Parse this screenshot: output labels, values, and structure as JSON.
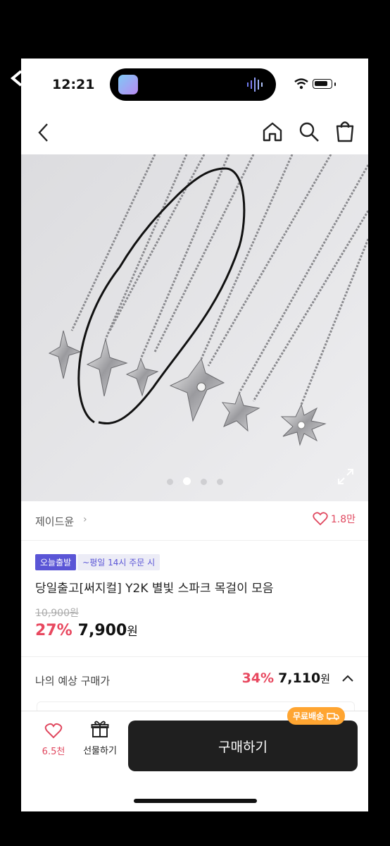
{
  "status_bar": {
    "time": "12:21"
  },
  "product": {
    "brand": "제이드윤",
    "brand_chevron": "›",
    "likes": "1.8만",
    "tag_primary": "오늘출발",
    "tag_secondary": "~평일 14시 주문 시",
    "title": "당일출고[써지컬] Y2K 별빛 스파크 목걸이 모음",
    "original_price": "10,900원",
    "discount": "27%",
    "price": "7,900",
    "currency": "원"
  },
  "estimate": {
    "label": "나의 예상 구매가",
    "discount": "34%",
    "price": "7,110",
    "currency": "원"
  },
  "carousel": {
    "total": 4,
    "active_index": 1
  },
  "bottom_bar": {
    "wish_count": "6.5천",
    "gift_label": "선물하기",
    "buy_label": "구매하기",
    "free_ship": "무료배송"
  },
  "colors": {
    "accent": "#e8485f",
    "tag": "#5a55d6",
    "ship": "#ffa531",
    "buy": "#1f1f1f"
  }
}
